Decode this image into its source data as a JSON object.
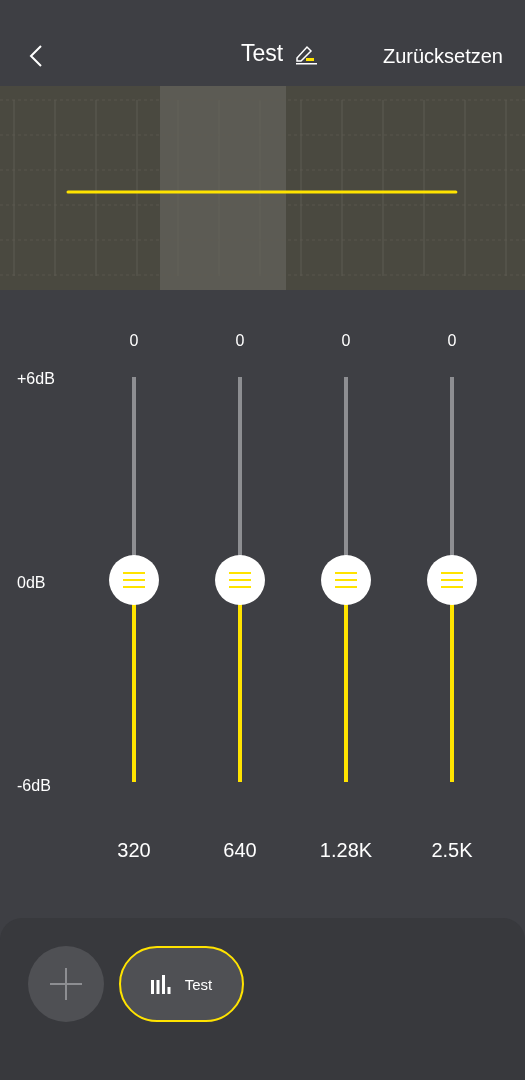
{
  "header": {
    "title": "Test",
    "reset": "Zurücksetzen"
  },
  "scale": [
    "+6dB",
    "0dB",
    "-6dB"
  ],
  "bands": [
    {
      "value": "0",
      "freq": "320",
      "level": 0.5
    },
    {
      "value": "0",
      "freq": "640",
      "level": 0.5
    },
    {
      "value": "0",
      "freq": "1.28K",
      "level": 0.5
    },
    {
      "value": "0",
      "freq": "2.5K",
      "level": 0.5
    }
  ],
  "presets": [
    {
      "label": "Test",
      "selected": true
    }
  ]
}
